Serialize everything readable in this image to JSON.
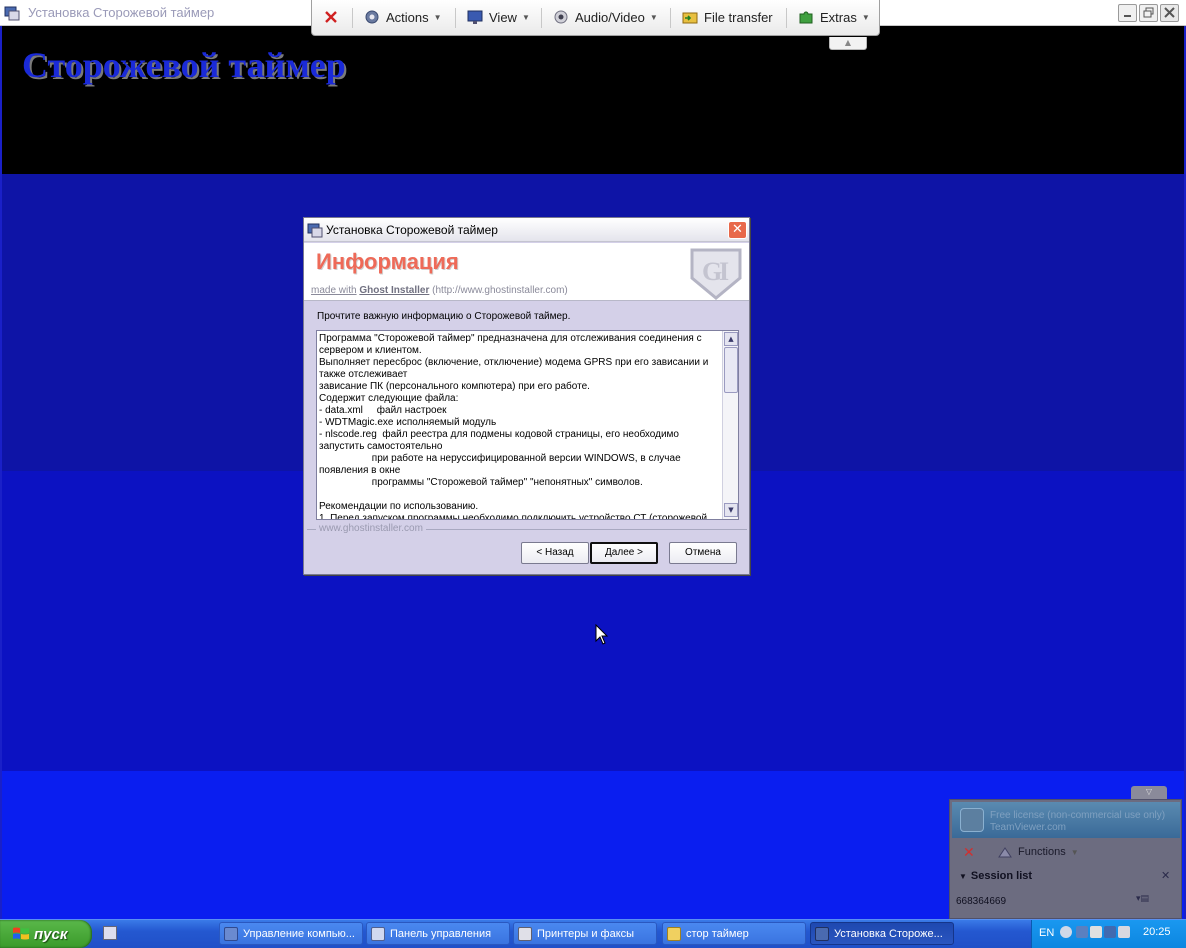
{
  "outer_window": {
    "title": "Установка Сторожевой таймер"
  },
  "installer_background": {
    "heading": "Сторожевой таймер",
    "colors": [
      "#000000",
      "#0e14a6",
      "#0c12c2",
      "#0a1ef0"
    ]
  },
  "teamviewer_toolbar": {
    "close_icon": "close-x-icon",
    "items": [
      {
        "label": "Actions",
        "icon": "gear-icon"
      },
      {
        "label": "View",
        "icon": "monitor-icon"
      },
      {
        "label": "Audio/Video",
        "icon": "webcam-icon"
      },
      {
        "label": "File transfer",
        "icon": "folder-transfer-icon"
      },
      {
        "label": "Extras",
        "icon": "puzzle-icon"
      }
    ]
  },
  "dialog": {
    "title": "Установка Сторожевой таймер",
    "header_title": "Информация",
    "made_with_prefix": "made with",
    "made_with_brand": "Ghost Installer",
    "made_with_url": "(http://www.ghostinstaller.com)",
    "prompt": "Прочтите важную информацию о Сторожевой таймер.",
    "info_text": "Программа \"Сторожевой таймер\" предназначена для отслеживания соединения с\nсервером и клиентом.\nВыполняет пересброс (включение, отключение) модема GPRS при его зависании и\nтакже отслеживает\nзависание ПК (персонального компютера) при его работе.\nСодержит следующие файла:\n- data.xml     файл настроек\n- WDTMagic.exe исполняемый модуль\n- nlscode.reg  файл реестра для подмены кодовой страницы, его необходимо\nзапустить самостоятельно\n                   при работе на нерусcифицированной версии WINDOWS, в случае\nпоявления в окне\n                   программы \"Сторожевой таймер\" \"непонятных\" символов.\n\nРекомендации по использованию.\n1. Перед запуском программы необходимо подключить устройство СТ (сторожевой",
    "footer_brand": "www.ghostinstaller.com",
    "buttons": {
      "back": "< Назад",
      "next": "Далее >",
      "cancel": "Отмена"
    }
  },
  "teamviewer_panel": {
    "banner_line1": "Free license (non-commercial use only)",
    "banner_line2": "TeamViewer.com",
    "functions_label": "Functions",
    "session_list_label": "Session list",
    "session_id": "668364669"
  },
  "taskbar": {
    "start_label": "пуск",
    "tasks": [
      {
        "label": "Управление компью...",
        "icon": "computer-management-icon",
        "active": false
      },
      {
        "label": "Панель управления",
        "icon": "control-panel-icon",
        "active": false
      },
      {
        "label": "Принтеры и факсы",
        "icon": "printer-icon",
        "active": false
      },
      {
        "label": "стор таймер",
        "icon": "folder-icon",
        "active": false
      },
      {
        "label": "Установка Стороже...",
        "icon": "installer-icon",
        "active": true
      }
    ],
    "tray": {
      "language": "EN",
      "clock": "20:25"
    }
  }
}
